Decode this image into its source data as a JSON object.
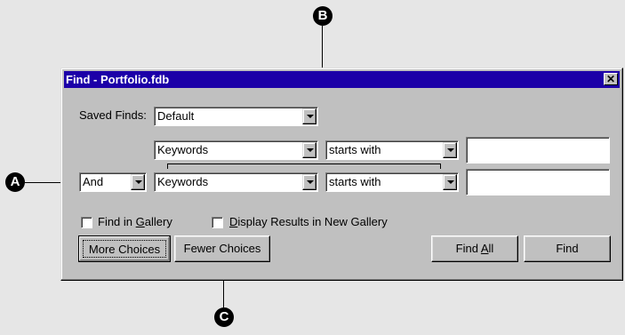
{
  "callouts": {
    "a": "A",
    "b": "B",
    "c": "C"
  },
  "dialog": {
    "title": "Find - Portfolio.fdb",
    "close_glyph": "✕",
    "saved_finds_label": "Saved Finds:",
    "saved_finds_value": "Default",
    "row1": {
      "field": "Keywords",
      "operator": "starts with",
      "value": ""
    },
    "row2": {
      "connector": "And",
      "field": "Keywords",
      "operator": "starts with",
      "value": ""
    },
    "find_in_gallery": {
      "pre": "Find in ",
      "key": "G",
      "post": "allery",
      "checked": false
    },
    "display_results": {
      "pre": "",
      "key": "D",
      "post": "isplay Results in New Gallery",
      "checked": false
    },
    "buttons": {
      "more_choices": "More Choices",
      "fewer_choices": "Fewer Choices",
      "find_all_pre": "Find ",
      "find_all_key": "A",
      "find_all_post": "ll",
      "find": "Find"
    }
  },
  "colors": {
    "titlebar": "#1c00a8",
    "face": "#c0c0c0",
    "background": "#e6e6e6"
  }
}
